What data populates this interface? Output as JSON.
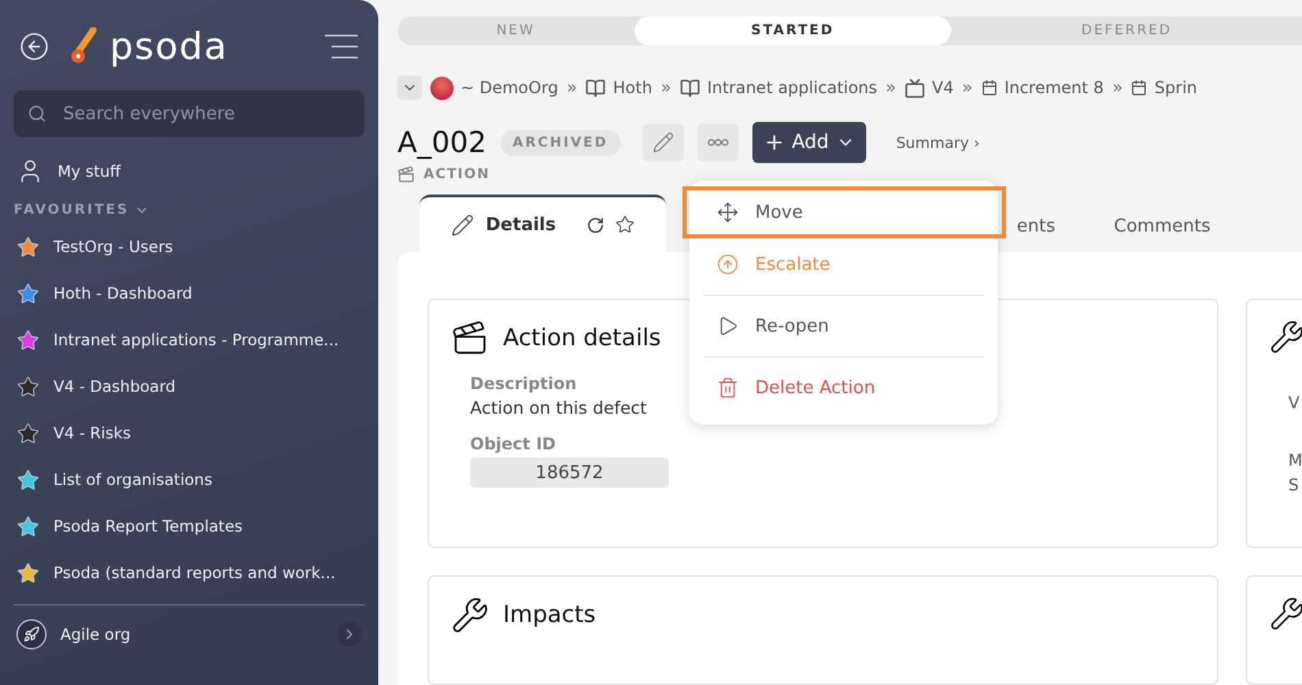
{
  "sidebar": {
    "logo": "psoda",
    "search": {
      "placeholder": "Search everywhere"
    },
    "my_stuff": "My stuff",
    "favourites_heading": "FAVOURITES",
    "favourites_expanded": true,
    "favourites": [
      {
        "label": "TestOrg - Users",
        "color": "#f08a3c"
      },
      {
        "label": "Hoth - Dashboard",
        "color": "#3d8fe6"
      },
      {
        "label": "Intranet applications - Programme...",
        "color": "#e03de0"
      },
      {
        "label": "V4 - Dashboard",
        "color": "#2b2b2b"
      },
      {
        "label": "V4 - Risks",
        "color": "#2b2b2b"
      },
      {
        "label": "List of organisations",
        "color": "#3ec8e0"
      },
      {
        "label": "Psoda Report Templates",
        "color": "#3ec8e0"
      },
      {
        "label": "Psoda (standard reports and work...",
        "color": "#e8b83a"
      }
    ],
    "org": "Agile org"
  },
  "status_steps": [
    {
      "label": "NEW",
      "selected": false
    },
    {
      "label": "STARTED",
      "selected": true
    },
    {
      "label": "DEFERRED",
      "selected": false
    }
  ],
  "breadcrumb": [
    {
      "label": "~ DemoOrg",
      "kind": "org"
    },
    {
      "label": "Hoth",
      "kind": "book",
      "separator": "»"
    },
    {
      "label": "Intranet applications",
      "kind": "book",
      "separator": "»"
    },
    {
      "label": "V4",
      "kind": "board",
      "separator": "»"
    },
    {
      "label": "Increment 8",
      "kind": "calendar",
      "separator": "»"
    },
    {
      "label": "Sprin",
      "kind": "calendar",
      "separator": "»"
    }
  ],
  "title": "A_002",
  "badge": "ARCHIVED",
  "type_label": "ACTION",
  "add_button": "Add",
  "summary_link": "Summary ›",
  "menu": [
    {
      "label": "Move",
      "kind": "move",
      "selected": true
    },
    {
      "label": "Escalate",
      "kind": "escalate",
      "selected": false
    },
    {
      "label": "Re-open",
      "kind": "reopen",
      "selected": false
    },
    {
      "label": "Delete Action",
      "kind": "delete",
      "selected": false
    }
  ],
  "tabs": [
    {
      "label": "Details",
      "selected": true
    },
    {
      "label": "ents",
      "selected": false
    },
    {
      "label": "Comments",
      "selected": false
    }
  ],
  "details_card": {
    "title": "Action details",
    "fields": [
      {
        "label": "Description",
        "value": "Action on this defect",
        "kind": "text"
      },
      {
        "label": "Object ID",
        "value": "186572",
        "kind": "readonly"
      }
    ]
  },
  "impacts_card": {
    "title": "Impacts"
  },
  "side_card": {
    "texts": [
      "V",
      "M",
      "S"
    ]
  }
}
